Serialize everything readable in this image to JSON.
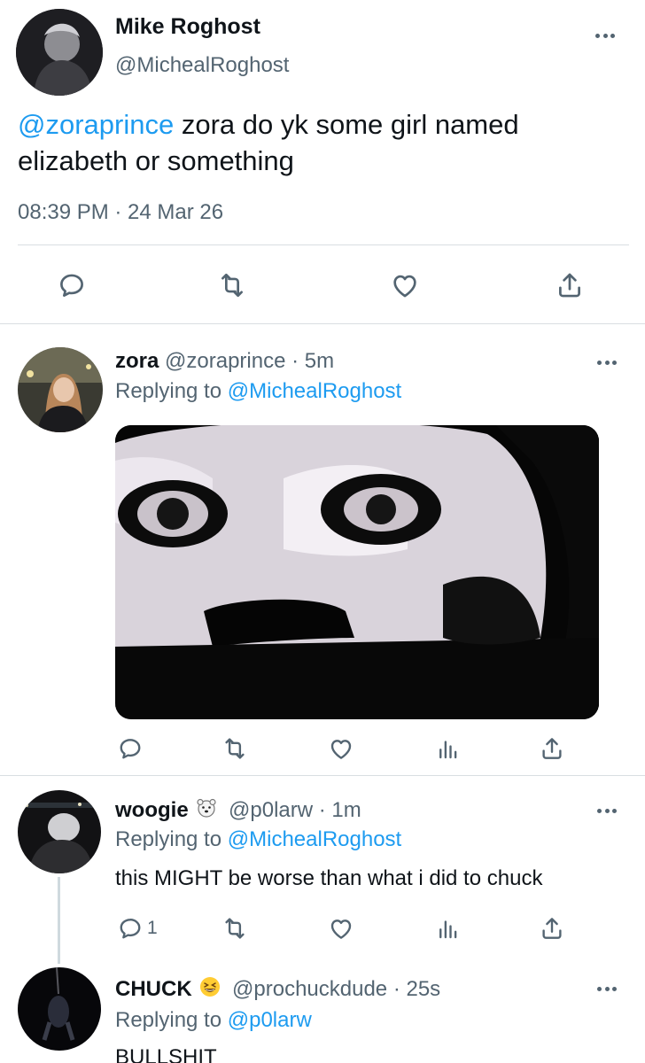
{
  "main_tweet": {
    "author_name": "Mike Roghost",
    "author_handle": "@MichealRoghost",
    "mention": "@zoraprince",
    "text": " zora do yk some girl named elizabeth or something",
    "timestamp": "08:39 PM · 24 Mar 26"
  },
  "replies": [
    {
      "name": "zora",
      "handle": "@zoraprince",
      "time": "· 5m",
      "replying_prefix": "Replying to ",
      "replying_to": "@MichealRoghost",
      "text": "",
      "media": "cat-face-image"
    },
    {
      "name": "woogie",
      "emoji": "polar-bear-emoji",
      "handle": "@p0larw",
      "time": "· 1m",
      "replying_prefix": "Replying to ",
      "replying_to": "@MichealRoghost",
      "text": "this MIGHT be worse than what i did to chuck",
      "reply_count": "1"
    },
    {
      "name": "CHUCK",
      "emoji": "grinning-squinting-face-emoji",
      "handle": "@prochuckdude",
      "time": "· 25s",
      "replying_prefix": "Replying to ",
      "replying_to": "@p0larw",
      "text": "BULLSHIT"
    }
  ],
  "icons": {
    "reply": "reply-icon",
    "retweet": "retweet-icon",
    "like": "heart-icon",
    "views": "views-icon",
    "share": "share-icon",
    "more": "more-icon"
  },
  "colors": {
    "link": "#1d9bf0",
    "secondary_text": "#536471",
    "divider": "#d9dee2"
  }
}
